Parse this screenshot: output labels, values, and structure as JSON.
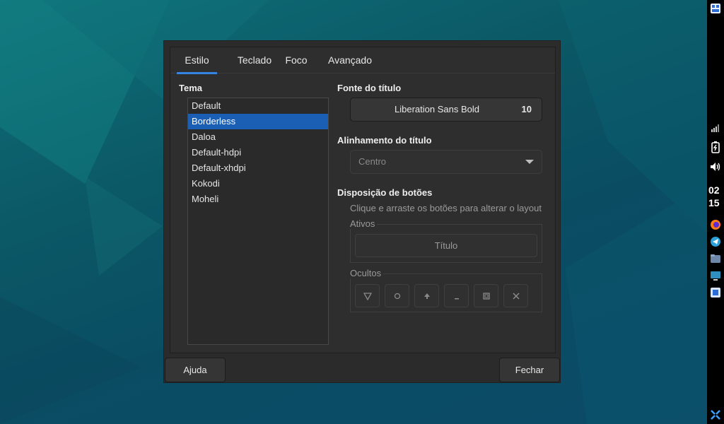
{
  "dialog": {
    "tabs": [
      {
        "label": "Estilo",
        "active": true
      },
      {
        "label": "Teclado",
        "active": false
      },
      {
        "label": "Foco",
        "active": false
      },
      {
        "label": "Avançado",
        "active": false
      }
    ],
    "theme": {
      "label": "Tema",
      "items": [
        "Default",
        "Borderless",
        "Daloa",
        "Default-hdpi",
        "Default-xhdpi",
        "Kokodi",
        "Moheli"
      ],
      "selected": "Borderless"
    },
    "title_font": {
      "label": "Fonte do título",
      "font_name": "Liberation Sans Bold",
      "font_size": "10"
    },
    "title_alignment": {
      "label": "Alinhamento do título",
      "value": "Centro"
    },
    "button_layout": {
      "label": "Disposição de botões",
      "hint": "Clique e arraste os botões para alterar o layout",
      "active_label": "Ativos",
      "active_item": "Título",
      "hidden_label": "Ocultos",
      "hidden_icons": [
        "shade-icon",
        "stick-icon",
        "above-icon",
        "minimize-icon",
        "maximize-icon",
        "close-icon"
      ]
    },
    "footer": {
      "help": "Ajuda",
      "close": "Fechar"
    }
  },
  "panel": {
    "clock_hour": "02",
    "clock_minute": "15"
  },
  "colors": {
    "accent": "#1a5fb4",
    "tab_indicator": "#3584e4",
    "dialog_bg": "#2e2e2e"
  }
}
